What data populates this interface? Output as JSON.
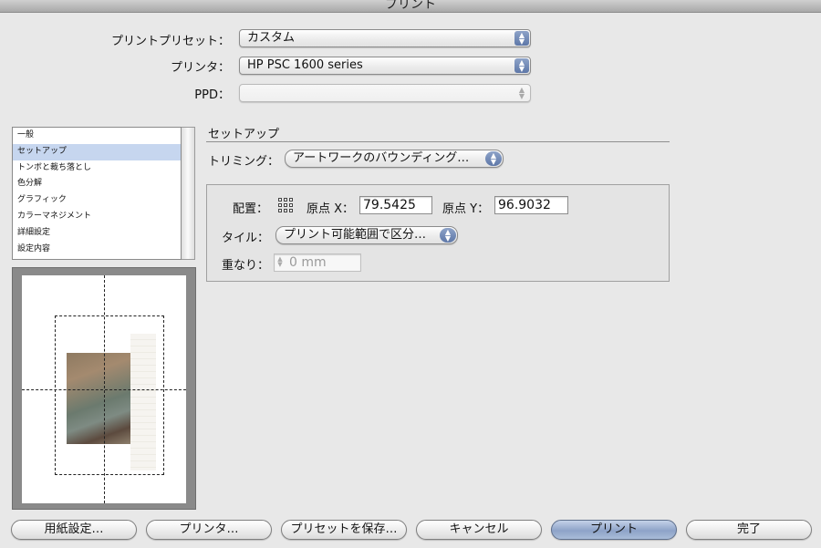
{
  "window": {
    "title": "プリント"
  },
  "header": {
    "preset_label": "プリントプリセット：",
    "preset_value": "カスタム",
    "printer_label": "プリンタ：",
    "printer_value": "HP PSC 1600 series",
    "ppd_label": "PPD：",
    "ppd_value": ""
  },
  "sidebar": {
    "items": [
      {
        "label": "一般"
      },
      {
        "label": "セットアップ",
        "selected": true
      },
      {
        "label": "トンボと裁ち落とし"
      },
      {
        "label": "色分解"
      },
      {
        "label": "グラフィック"
      },
      {
        "label": "カラーマネジメント"
      },
      {
        "label": "詳細設定"
      },
      {
        "label": "設定内容"
      }
    ]
  },
  "setup": {
    "title": "セットアップ",
    "crop_label": "トリミング：",
    "crop_value": "アートワークのバウンディング…",
    "placement_label": "配置：",
    "origin_x_label": "原点 X：",
    "origin_x_value": "79.5425",
    "origin_y_label": "原点 Y：",
    "origin_y_value": "96.9032",
    "tile_label": "タイル：",
    "tile_value": "プリント可能範囲で区分…",
    "overlap_label": "重なり：",
    "overlap_value": "0 mm"
  },
  "icons": {
    "popup_arrows": "up-down-arrows-icon",
    "reference_point": "reference-point-grid-icon"
  },
  "colors": {
    "accent": "#8ea3c8",
    "selection": "#c6d6ef"
  },
  "buttons": {
    "page_setup": "用紙設定…",
    "printer": "プリンタ…",
    "save_preset": "プリセットを保存…",
    "cancel": "キャンセル",
    "print": "プリント",
    "done": "完了"
  }
}
